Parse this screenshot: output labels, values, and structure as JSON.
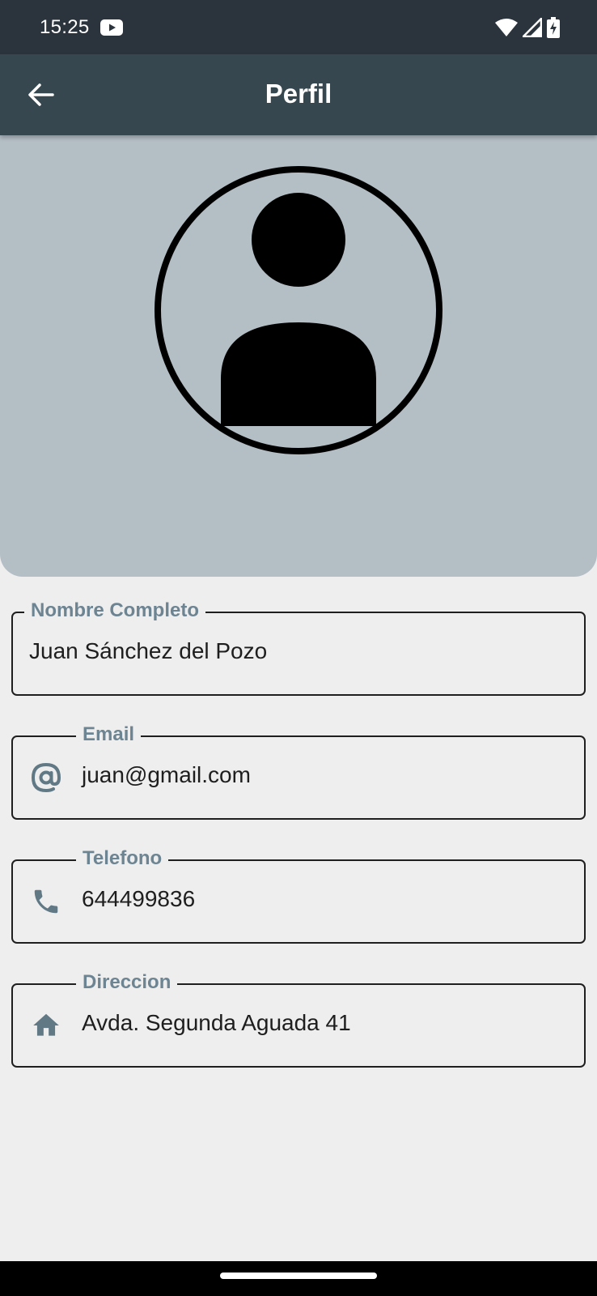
{
  "status_bar": {
    "time": "15:25",
    "icons": [
      "youtube-icon",
      "wifi-icon",
      "signal-icon",
      "battery-charging-icon"
    ]
  },
  "app_bar": {
    "title": "Perfil",
    "back_icon": "arrow-left-icon"
  },
  "profile": {
    "avatar_icon": "account-circle-icon"
  },
  "fields": {
    "name": {
      "label": "Nombre Completo",
      "value": "Juan Sánchez del Pozo"
    },
    "email": {
      "label": "Email",
      "value": "juan@gmail.com",
      "icon": "at-sign-icon"
    },
    "phone": {
      "label": "Telefono",
      "value": "644499836",
      "icon": "phone-icon"
    },
    "address": {
      "label": "Direccion",
      "value": "Avda. Segunda Aguada 41",
      "icon": "home-icon"
    }
  },
  "colors": {
    "status_bar": "#2b333d",
    "app_bar": "#37474f",
    "header_panel": "#b4bec5",
    "background": "#eeeeee",
    "label": "#6d8492",
    "icon": "#617985"
  }
}
